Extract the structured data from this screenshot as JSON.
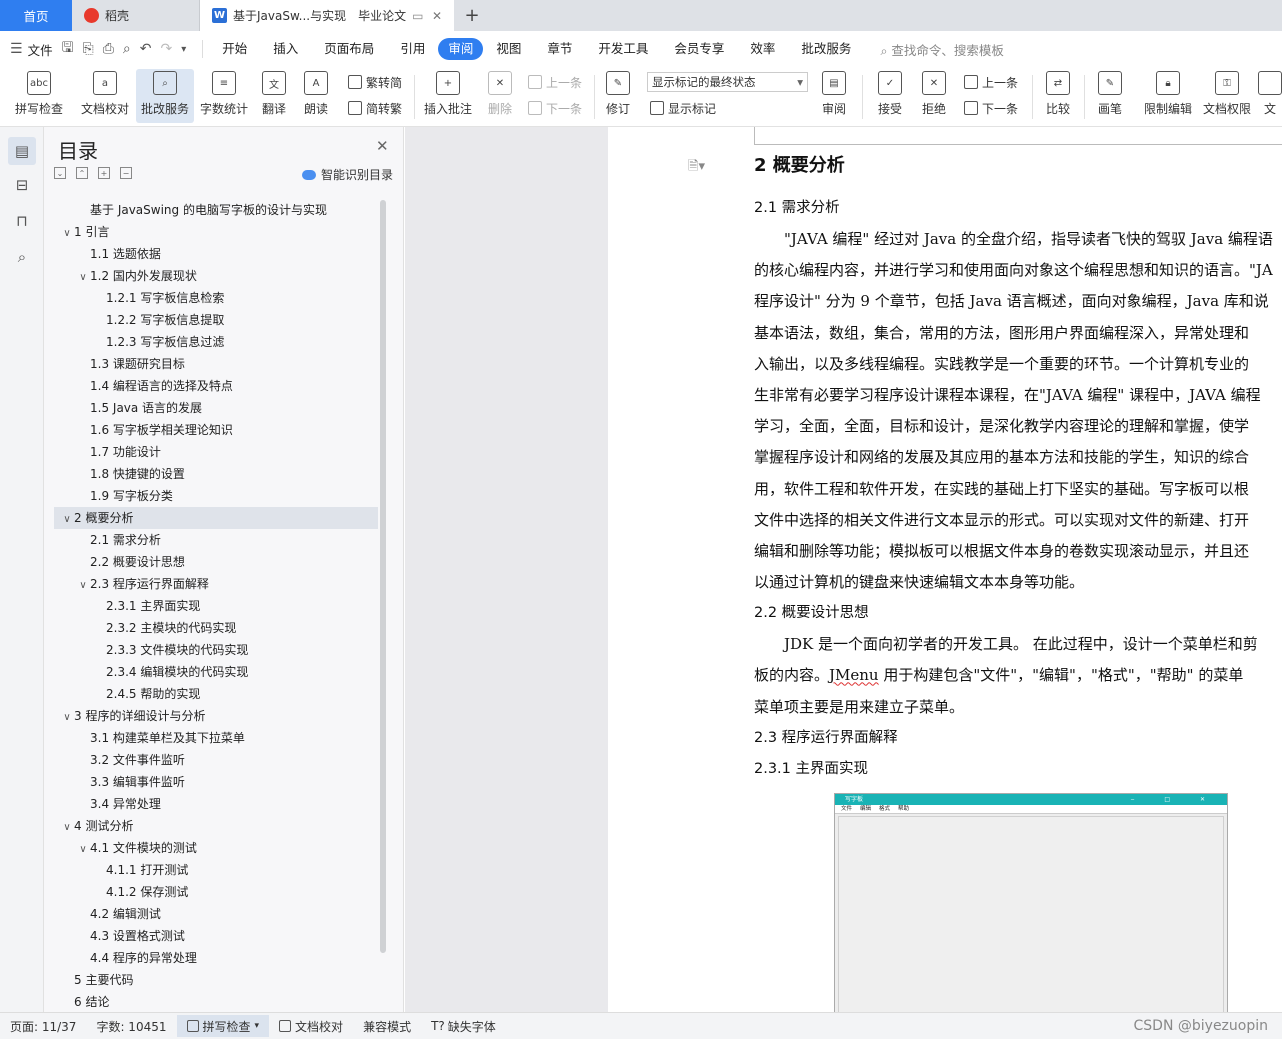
{
  "tabs": {
    "home": "首页",
    "daoke": "稻壳",
    "doc": "基于JavaSw...与实现",
    "doc_extra": "毕业论文",
    "add": "+"
  },
  "menu": {
    "file": "文件",
    "items": [
      "开始",
      "插入",
      "页面布局",
      "引用",
      "审阅",
      "视图",
      "章节",
      "开发工具",
      "会员专享",
      "效率",
      "批改服务"
    ],
    "active_index": 4,
    "search": "查找命令、搜索模板"
  },
  "ribbon": {
    "spell": "拼写检查",
    "proof": "文档校对",
    "correct": "批改服务",
    "wordcount": "字数统计",
    "translate": "翻译",
    "read": "朗读",
    "to_trad": "繁转简",
    "to_simp": "简转繁",
    "insert_comment": "插入批注",
    "delete": "删除",
    "prev": "上一条",
    "next": "下一条",
    "revise": "修订",
    "display_state": "显示标记的最终状态",
    "show_marks": "显示标记",
    "review": "审阅",
    "accept": "接受",
    "reject": "拒绝",
    "prev2": "上一条",
    "next2": "下一条",
    "compare": "比较",
    "pen": "画笔",
    "restrict": "限制编辑",
    "doc_perm": "文档权限",
    "doc_more": "文"
  },
  "toc": {
    "title": "目录",
    "smart": "智能识别目录",
    "items": [
      {
        "text": "基于 JavaSwing 的电脑写字板的设计与实现",
        "level": 1,
        "arrow": ""
      },
      {
        "text": "1  引言",
        "level": 0,
        "arrow": "v"
      },
      {
        "text": "1.1  选题依据",
        "level": 1,
        "arrow": ""
      },
      {
        "text": "1.2  国内外发展现状",
        "level": 1,
        "arrow": "v"
      },
      {
        "text": "1.2.1  写字板信息检索",
        "level": 2,
        "arrow": ""
      },
      {
        "text": "1.2.2  写字板信息提取",
        "level": 2,
        "arrow": ""
      },
      {
        "text": "1.2.3  写字板信息过滤",
        "level": 2,
        "arrow": ""
      },
      {
        "text": "1.3  课题研究目标",
        "level": 1,
        "arrow": ""
      },
      {
        "text": "1.4  编程语言的选择及特点",
        "level": 1,
        "arrow": ""
      },
      {
        "text": "1.5 Java 语言的发展",
        "level": 1,
        "arrow": ""
      },
      {
        "text": "1.6  写字板学相关理论知识",
        "level": 1,
        "arrow": ""
      },
      {
        "text": "1.7  功能设计",
        "level": 1,
        "arrow": ""
      },
      {
        "text": "1.8  快捷键的设置",
        "level": 1,
        "arrow": ""
      },
      {
        "text": "1.9  写字板分类",
        "level": 1,
        "arrow": ""
      },
      {
        "text": "2  概要分析",
        "level": 0,
        "arrow": "v",
        "selected": true
      },
      {
        "text": "2.1  需求分析",
        "level": 1,
        "arrow": ""
      },
      {
        "text": "2.2  概要设计思想",
        "level": 1,
        "arrow": ""
      },
      {
        "text": "2.3  程序运行界面解释",
        "level": 1,
        "arrow": "v"
      },
      {
        "text": "2.3.1  主界面实现",
        "level": 2,
        "arrow": ""
      },
      {
        "text": "2.3.2  主模块的代码实现",
        "level": 2,
        "arrow": ""
      },
      {
        "text": "2.3.3  文件模块的代码实现",
        "level": 2,
        "arrow": ""
      },
      {
        "text": "2.3.4  编辑模块的代码实现",
        "level": 2,
        "arrow": ""
      },
      {
        "text": "2.4.5  帮助的实现",
        "level": 2,
        "arrow": ""
      },
      {
        "text": "3  程序的详细设计与分析",
        "level": 0,
        "arrow": "v"
      },
      {
        "text": "3.1  构建菜单栏及其下拉菜单",
        "level": 1,
        "arrow": ""
      },
      {
        "text": "3.2  文件事件监听",
        "level": 1,
        "arrow": ""
      },
      {
        "text": "3.3  编辑事件监听",
        "level": 1,
        "arrow": ""
      },
      {
        "text": "3.4  异常处理",
        "level": 1,
        "arrow": ""
      },
      {
        "text": "4  测试分析",
        "level": 0,
        "arrow": "v"
      },
      {
        "text": "4.1  文件模块的测试",
        "level": 1,
        "arrow": "v"
      },
      {
        "text": "4.1.1  打开测试",
        "level": 2,
        "arrow": ""
      },
      {
        "text": "4.1.2  保存测试",
        "level": 2,
        "arrow": ""
      },
      {
        "text": "4.2  编辑测试",
        "level": 1,
        "arrow": ""
      },
      {
        "text": "4.3  设置格式测试",
        "level": 1,
        "arrow": ""
      },
      {
        "text": "4.4  程序的异常处理",
        "level": 1,
        "arrow": ""
      },
      {
        "text": "5  主要代码",
        "level": 0,
        "arrow": ""
      },
      {
        "text": "6  结论",
        "level": 0,
        "arrow": ""
      }
    ]
  },
  "doc": {
    "h1": "2  概要分析",
    "s21": "2.1  需求分析",
    "p1": [
      "\"JAVA 编程\" 经过对 Java 的全盘介绍，指导读者飞快的驾驭 Java 编程语",
      "的核心编程内容，并进行学习和使用面向对象这个编程思想和知识的语言。\"JA",
      "程序设计\" 分为 9 个章节，包括 Java 语言概述，面向对象编程，Java 库和说",
      "基本语法，数组，集合，常用的方法，图形用户界面编程深入，异常处理和",
      "入输出，以及多线程编程。实践教学是一个重要的环节。一个计算机专业的",
      "生非常有必要学习程序设计课程本课程，在\"JAVA 编程\" 课程中，JAVA 编程",
      "学习，全面，全面，目标和设计，是深化教学内容理论的理解和掌握，使学",
      "掌握程序设计和网络的发展及其应用的基本方法和技能的学生，知识的综合",
      "用，软件工程和软件开发，在实践的基础上打下坚实的基础。写字板可以根",
      "文件中选择的相关文件进行文本显示的形式。可以实现对文件的新建、打开",
      "编辑和删除等功能；模拟板可以根据文件本身的卷数实现滚动显示，并且还",
      "以通过计算机的键盘来快速编辑文本本身等功能。"
    ],
    "s22": "2.2  概要设计思想",
    "p2_1": "JDK 是一个面向初学者的开发工具。 在此过程中，设计一个菜单栏和剪",
    "p2_2a": "板的内容。",
    "p2_2err": "JMenu",
    "p2_2b": " 用于构建包含\"文件\"，\"编辑\"，\"格式\"，\"帮助\" 的菜单",
    "p2_3": "菜单项主要是用来建立子菜单。",
    "s23": "2.3  程序运行界面解释",
    "s231": "2.3.1  主界面实现",
    "shot_title": "写字板",
    "shot_menu": [
      "文件",
      "编辑",
      "格式",
      "帮助"
    ]
  },
  "status": {
    "page": "页面: 11/37",
    "words": "字数: 10451",
    "spell": "拼写检查",
    "proof": "文档校对",
    "compat": "兼容模式",
    "missing_font": "缺失字体"
  },
  "watermark": "CSDN @biyezuopin"
}
